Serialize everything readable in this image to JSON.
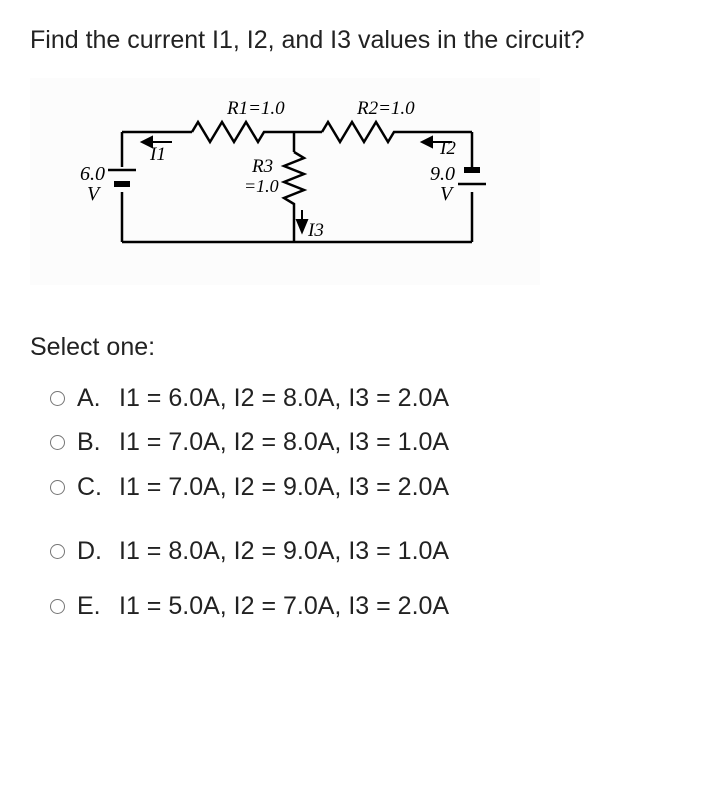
{
  "question": "Find the current I1, I2, and I3 values in the circuit?",
  "circuit": {
    "R1": "R1=1.0",
    "R2": "R2=1.0",
    "R3_top": "R3",
    "R3_bot": "=1.0",
    "V_left_top": "6.0",
    "V_left_bot": "V",
    "V_right_top": "9.0",
    "V_right_bot": "V",
    "I1": "I1",
    "I2": "I2",
    "I3": "I3"
  },
  "select_label": "Select one:",
  "options": [
    {
      "letter": "A.",
      "text": "I1 = 6.0A, I2 = 8.0A, I3 = 2.0A"
    },
    {
      "letter": "B.",
      "text": "I1 = 7.0A, I2 = 8.0A, I3 = 1.0A"
    },
    {
      "letter": "C.",
      "text": "I1 = 7.0A, I2 = 9.0A, I3 = 2.0A"
    },
    {
      "letter": "D.",
      "text": "I1 = 8.0A, I2 = 9.0A, I3 = 1.0A"
    },
    {
      "letter": "E.",
      "text": "I1 = 5.0A, I2 = 7.0A, I3 = 2.0A"
    }
  ]
}
